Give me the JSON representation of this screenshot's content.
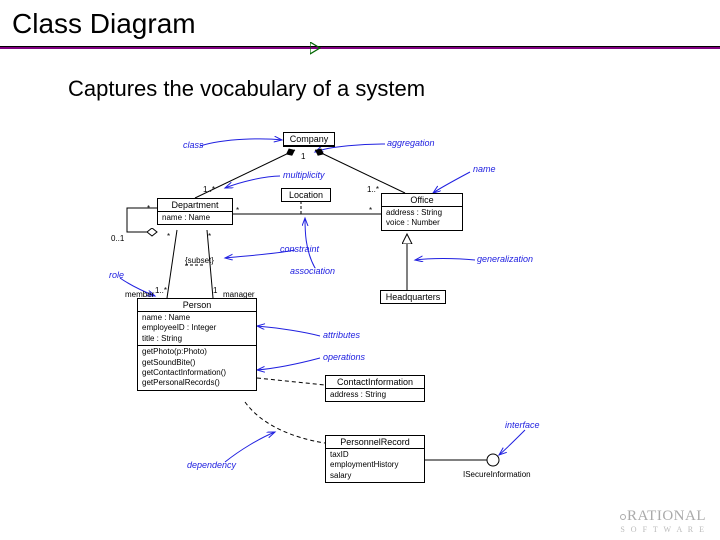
{
  "title": "Class Diagram",
  "subtitle": "Captures the vocabulary of a system",
  "classes": {
    "company": {
      "name": "Company"
    },
    "department": {
      "name": "Department",
      "attr": "name : Name"
    },
    "office": {
      "name": "Office",
      "attr1": "address : String",
      "attr2": "voice : Number"
    },
    "location": {
      "name": "Location"
    },
    "headquarters": {
      "name": "Headquarters"
    },
    "person": {
      "name": "Person",
      "attr1": "name : Name",
      "attr2": "employeeID : Integer",
      "attr3": "title : String",
      "op1": "getPhoto(p:Photo)",
      "op2": "getSoundBite()",
      "op3": "getContactInformation()",
      "op4": "getPersonalRecords()"
    },
    "contact": {
      "name": "ContactInformation",
      "attr": "address : String"
    },
    "personnel": {
      "name": "PersonnelRecord",
      "attr1": "taxID",
      "attr2": "employmentHistory",
      "attr3": "salary"
    },
    "isecure": {
      "name": "ISecureInformation"
    }
  },
  "annotations": {
    "class": "class",
    "aggregation": "aggregation",
    "multiplicity": "multiplicity",
    "name": "name",
    "constraint": "constraint",
    "association": "association",
    "generalization": "generalization",
    "role": "role",
    "attributes": "attributes",
    "operations": "operations",
    "dependency": "dependency",
    "interface": "interface"
  },
  "multiplicities": {
    "one": "1",
    "one_many": "1..*",
    "star": "*",
    "zero_one": "0..1",
    "subset": "{subset}",
    "member": "member",
    "manager": "manager"
  },
  "brand": {
    "name": "RATIONAL",
    "sub": "S O F T W A R E"
  }
}
